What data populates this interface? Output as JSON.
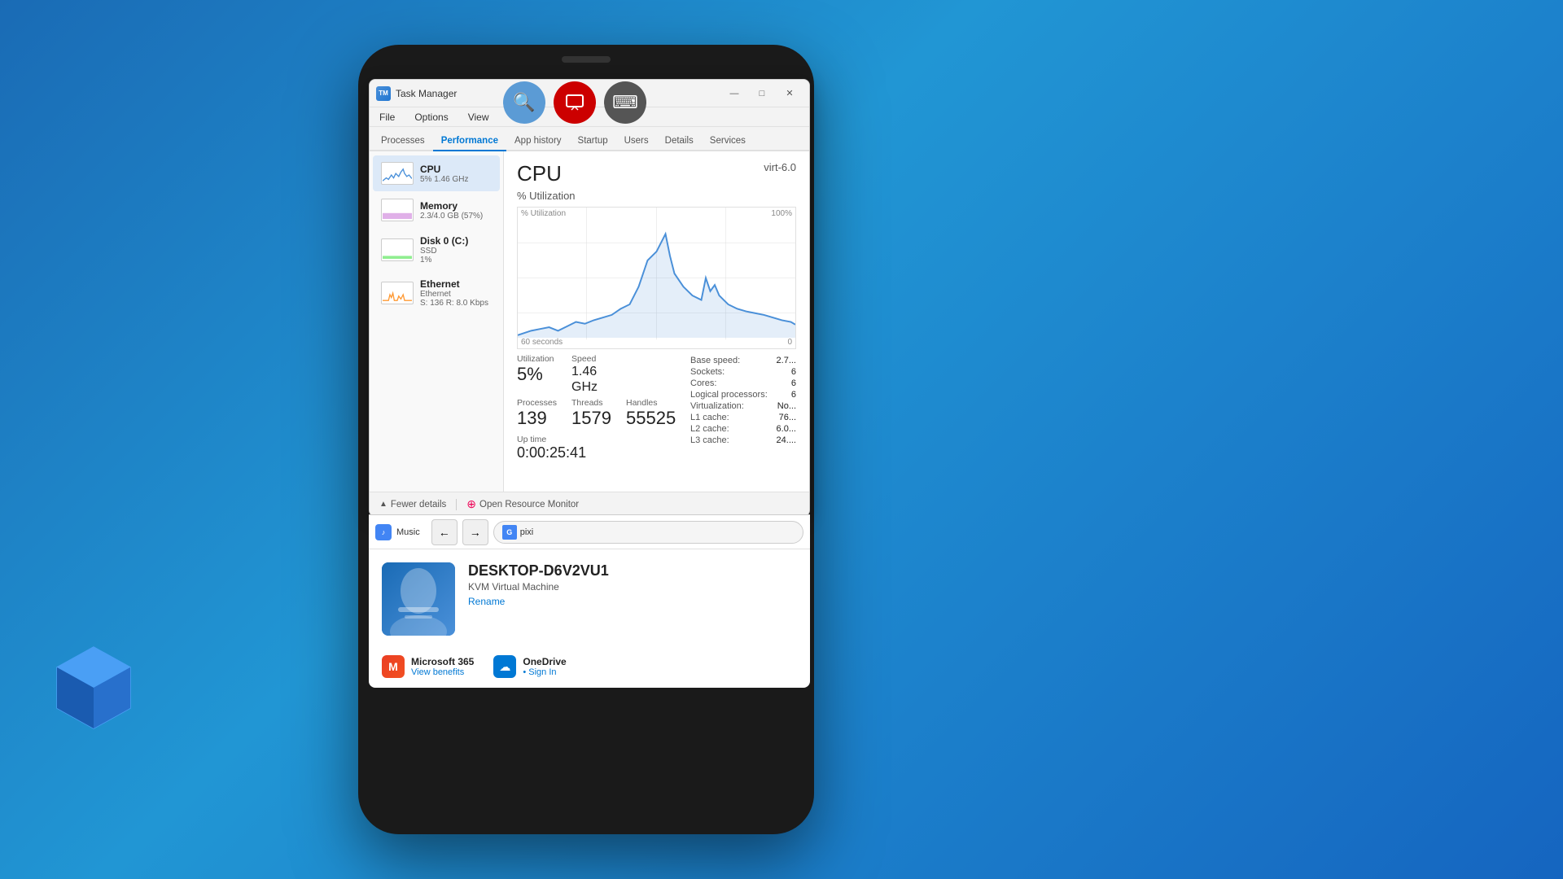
{
  "background": "#1a6bb5",
  "toolbar": {
    "search_icon": "🔍",
    "remote_icon": "🖥",
    "keyboard_icon": "⌨"
  },
  "window": {
    "title": "Task Manager",
    "icon": "TM",
    "controls": {
      "minimize": "—",
      "maximize": "□",
      "close": "✕"
    }
  },
  "menu": {
    "items": [
      "File",
      "Options",
      "View"
    ]
  },
  "tabs": [
    "Processes",
    "Performance",
    "App history",
    "Startup",
    "Users",
    "Details",
    "Services"
  ],
  "active_tab": "Performance",
  "sidebar": {
    "items": [
      {
        "name": "CPU",
        "detail1": "5% 1.46 GHz",
        "detail2": "",
        "type": "cpu"
      },
      {
        "name": "Memory",
        "detail1": "2.3/4.0 GB (57%)",
        "detail2": "",
        "type": "memory"
      },
      {
        "name": "Disk 0 (C:)",
        "detail1": "SSD",
        "detail2": "1%",
        "type": "disk"
      },
      {
        "name": "Ethernet",
        "detail1": "Ethernet",
        "detail2": "S: 136 R: 8.0 Kbps",
        "type": "ethernet"
      }
    ]
  },
  "cpu_detail": {
    "title": "CPU",
    "model": "virt-6.0",
    "utilization_label": "% Utilization",
    "utilization_max": "100%",
    "time_label": "60 seconds",
    "time_end": "0",
    "stats": {
      "utilization_label": "Utilization",
      "utilization_value": "5%",
      "speed_label": "Speed",
      "speed_value": "1.46 GHz",
      "processes_label": "Processes",
      "processes_value": "139",
      "threads_label": "Threads",
      "threads_value": "1579",
      "handles_label": "Handles",
      "handles_value": "55525",
      "uptime_label": "Up time",
      "uptime_value": "0:00:25:41"
    },
    "right_info": {
      "base_speed_label": "Base speed:",
      "base_speed_value": "2.7...",
      "sockets_label": "Sockets:",
      "sockets_value": "6",
      "cores_label": "Cores:",
      "cores_value": "6",
      "logical_label": "Logical processors:",
      "logical_value": "6",
      "virt_label": "Virtualization:",
      "virt_value": "No...",
      "l1_label": "L1 cache:",
      "l1_value": "76...",
      "l2_label": "L2 cache:",
      "l2_value": "6.0...",
      "l3_label": "L3 cache:",
      "l3_value": "24...."
    }
  },
  "footer": {
    "fewer_details": "Fewer details",
    "open_resource_monitor": "Open Resource Monitor"
  },
  "taskbar": {
    "back": "←",
    "forward": "→",
    "address": "pixi",
    "google_label": "G"
  },
  "system_info": {
    "hostname": "DESKTOP-D6V2VU1",
    "type": "KVM Virtual Machine",
    "rename": "Rename"
  },
  "apps": [
    {
      "name": "Microsoft 365",
      "sub": "View benefits",
      "icon_type": "ms365",
      "icon_text": "M"
    },
    {
      "name": "OneDrive",
      "sub": "• Sign In",
      "icon_type": "onedrive",
      "icon_text": "☁"
    }
  ],
  "music_tab": {
    "label": "Music",
    "icon": "♪"
  }
}
